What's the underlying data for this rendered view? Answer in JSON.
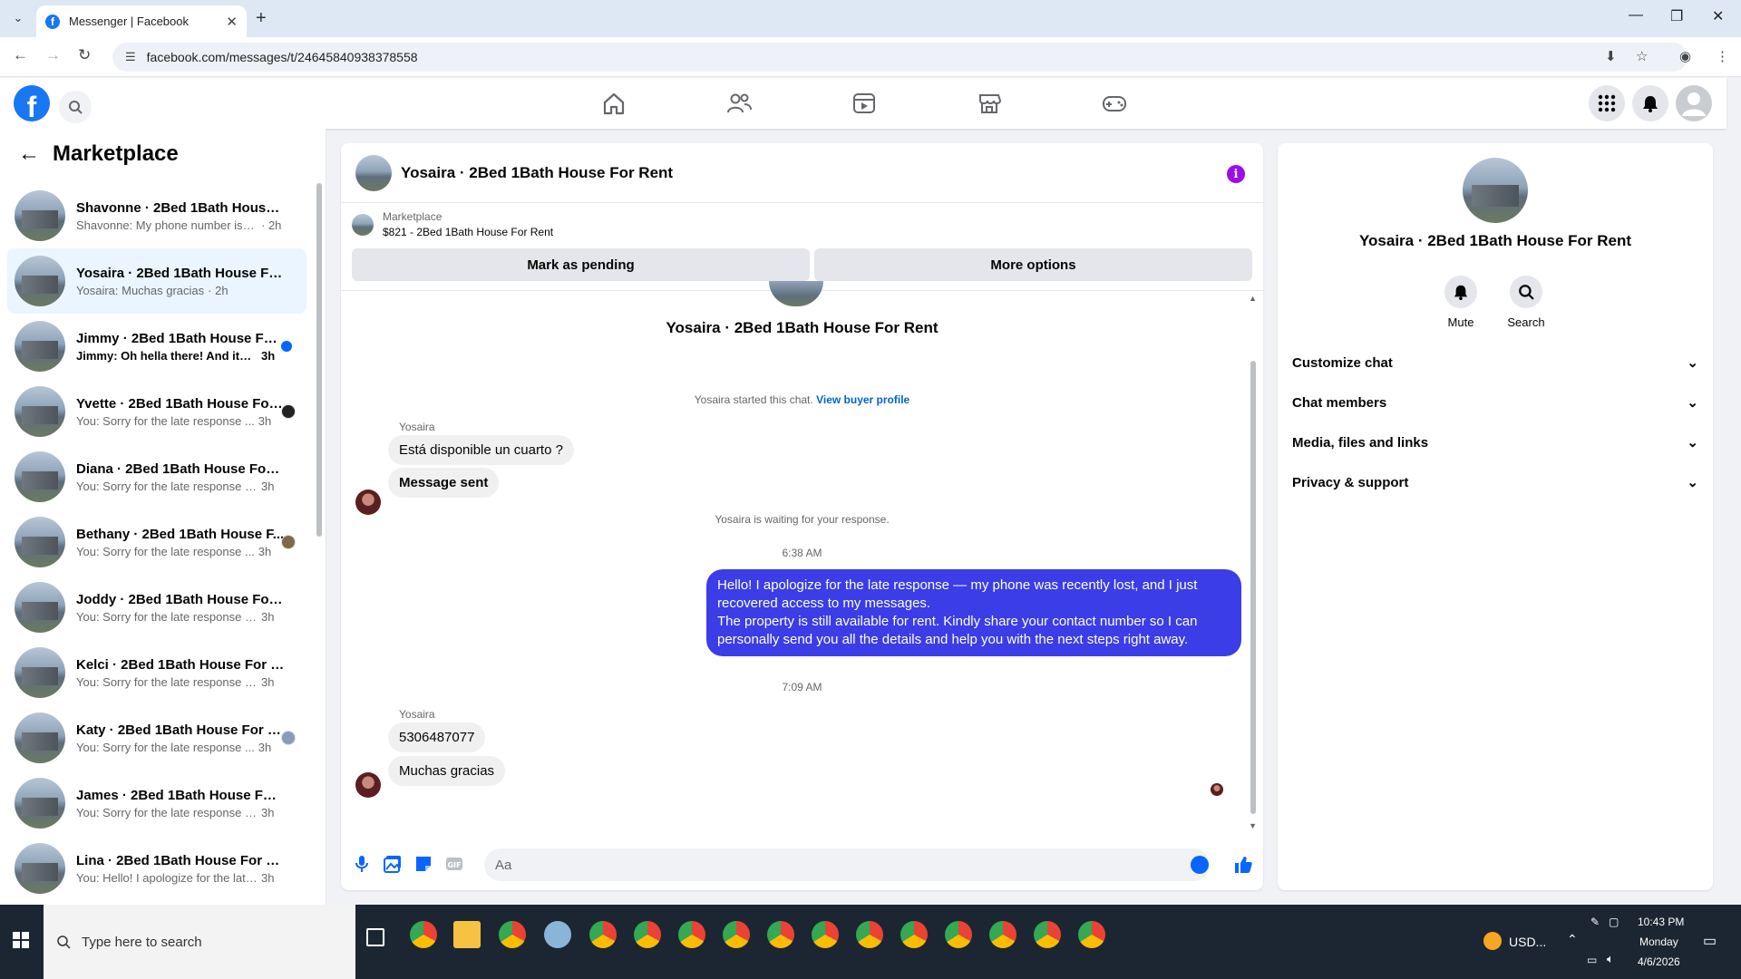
{
  "browser": {
    "tab_title": "Messenger | Facebook",
    "url": "facebook.com/messages/t/24645840938378558"
  },
  "sidebar": {
    "title": "Marketplace",
    "conversations": [
      {
        "name": "Shavonne · 2Bed 1Bath House F...",
        "snippet": "Shavonne: My phone number is 53...",
        "time": "· 2h",
        "state": "normal"
      },
      {
        "name": "Yosaira · 2Bed 1Bath House For ...",
        "snippet": "Yosaira: Muchas gracias",
        "time": "· 2h",
        "state": "active"
      },
      {
        "name": "Jimmy · 2Bed 1Bath House For...",
        "snippet": "Jimmy: Oh hella there! And its al...",
        "time": "3h",
        "state": "unread"
      },
      {
        "name": "Yvette · 2Bed 1Bath House For...",
        "snippet": "You: Sorry for the late response ...",
        "time": "3h",
        "state": "seen"
      },
      {
        "name": "Diana · 2Bed 1Bath House For R...",
        "snippet": "You: Sorry for the late response — ...",
        "time": "3h",
        "state": "normal"
      },
      {
        "name": "Bethany · 2Bed 1Bath House F...",
        "snippet": "You: Sorry for the late response ...",
        "time": "3h",
        "state": "seen"
      },
      {
        "name": "Joddy · 2Bed 1Bath House For R...",
        "snippet": "You: Sorry for the late response — ...",
        "time": "3h",
        "state": "normal"
      },
      {
        "name": "Kelci · 2Bed 1Bath House For Rent",
        "snippet": "You: Sorry for the late response — ...",
        "time": "3h",
        "state": "normal"
      },
      {
        "name": "Katy · 2Bed 1Bath House For R...",
        "snippet": "You: Sorry for the late response ...",
        "time": "3h",
        "state": "seen"
      },
      {
        "name": "James · 2Bed 1Bath House For R...",
        "snippet": "You: Sorry for the late response — ...",
        "time": "3h",
        "state": "normal"
      },
      {
        "name": "Lina · 2Bed 1Bath House For Rent",
        "snippet": "You: Hello! I apologize for the late r...",
        "time": "3h",
        "state": "normal"
      }
    ]
  },
  "chat": {
    "header_name": "Yosaira · 2Bed 1Bath House For Rent",
    "listing_label": "Marketplace",
    "listing_detail": "$821 - 2Bed 1Bath House For Rent",
    "mark_pending": "Mark as pending",
    "more_options": "More options",
    "center_name": "Yosaira · 2Bed 1Bath House For Rent",
    "started_text": "Yosaira started this chat.",
    "buyer_profile_link": "View buyer profile",
    "sender_name": "Yosaira",
    "msg1": "Está disponible un cuarto ?",
    "msg2": "Message sent",
    "waiting_text": "Yosaira is waiting for your response.",
    "time1": "6:38 AM",
    "out_line1": "Hello! I apologize for the late response — my phone was recently lost, and I just recovered access to my messages.",
    "out_line2": "The property is still available for rent. Kindly share your contact number so I can personally send you all the details and help you with the next steps right away.",
    "time2": "7:09 AM",
    "sender_name2": "Yosaira",
    "msg3": "5306487077",
    "msg4": "Muchas gracias",
    "input_placeholder": "Aa",
    "accent_color": "#3b3de6"
  },
  "info_panel": {
    "name": "Yosaira · 2Bed 1Bath House For Rent",
    "mute": "Mute",
    "search": "Search",
    "sections": [
      "Customize chat",
      "Chat members",
      "Media, files and links",
      "Privacy & support"
    ]
  },
  "taskbar": {
    "search_placeholder": "Type here to search",
    "currency": "USD...",
    "time": "10:43 PM",
    "day": "Monday",
    "date": "4/6/2026"
  }
}
